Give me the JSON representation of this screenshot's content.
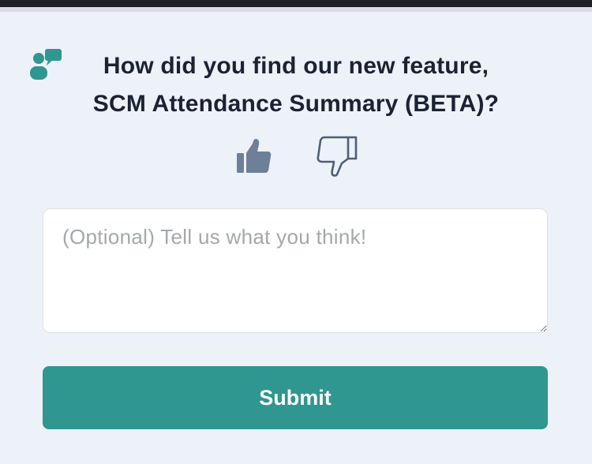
{
  "question": {
    "line1": "How did you find our new feature,",
    "line2": "SCM Attendance Summary (BETA)?"
  },
  "icons": {
    "feedback": "feedback-chat-icon",
    "thumbs_up": "thumbs-up-icon",
    "thumbs_down": "thumbs-down-icon"
  },
  "comment": {
    "value": "",
    "placeholder": "(Optional) Tell us what you think!"
  },
  "submit": {
    "label": "Submit"
  },
  "colors": {
    "background": "#edf1f8",
    "accent": "#2f9690",
    "thumb_up_fill": "#6e7f98",
    "thumb_down_stroke": "#4f5f75"
  }
}
